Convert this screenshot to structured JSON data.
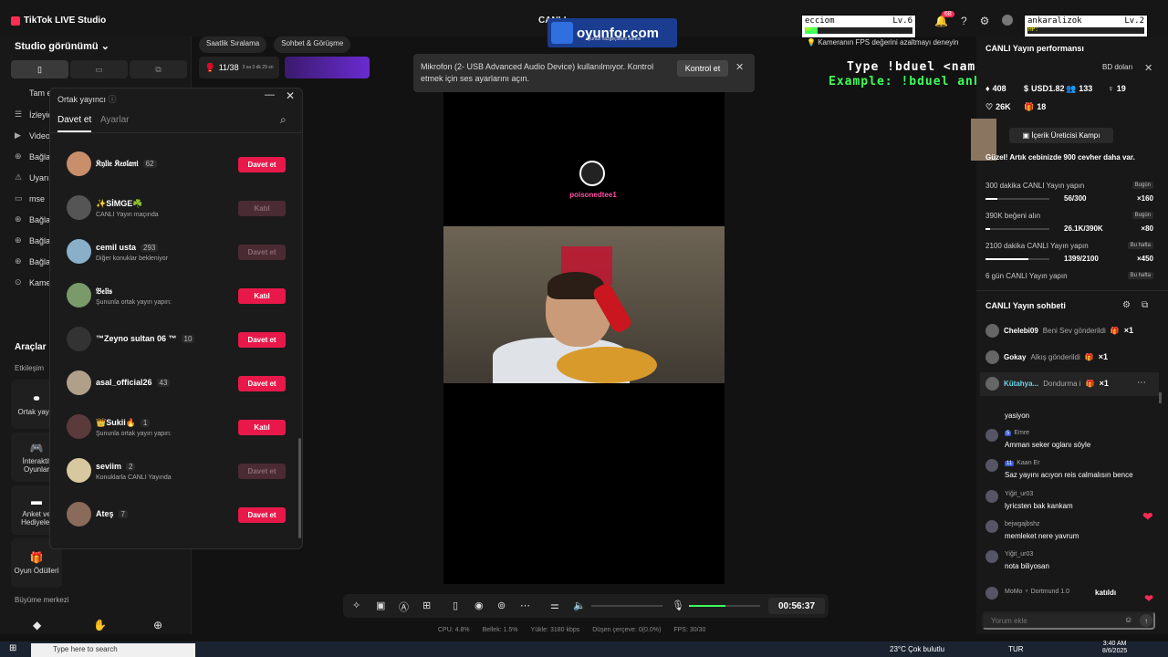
{
  "app": {
    "title": "TikTok LIVE Studio",
    "studio_view": "Studio görünümü",
    "center_title": "CANLI"
  },
  "left_sources": [
    "Tam ekran",
    "İzleyiciler",
    "Video",
    "Bağlantı",
    "Uyarılar",
    "mse",
    "Bağlantı",
    "Bağlantı",
    "Bağlantı",
    "Kamera"
  ],
  "tools": {
    "heading": "Araçlar",
    "sub": "Etkileşim",
    "items": [
      "Ortak yayın",
      "İnteraktif Oyunlar",
      "Anket ve Hediyeler",
      "Oyun Ödülleri"
    ],
    "growth": "Büyüme merkezi"
  },
  "chips": [
    "Saatlik Sıralama",
    "Sohbet & Görüşme"
  ],
  "rank": {
    "value": "11/38",
    "sub": "3 sa 3 dk 29 sn"
  },
  "cohost": {
    "title": "Ortak yayıncı",
    "tab_invite": "Davet et",
    "tab_settings": "Ayarlar",
    "users": [
      {
        "name": "𝔎𝔶𝔩𝔦𝔢 𝔎𝔢𝔬𝔩𝔞𝔫𝔦",
        "count": "62",
        "sub": "",
        "btn": "Davet et",
        "disabled": false,
        "color": "#c88f6a"
      },
      {
        "name": "✨SİMGE☘️",
        "count": "",
        "sub": "CANLI Yayın maçında",
        "btn": "Katıl",
        "disabled": true,
        "color": "#555"
      },
      {
        "name": "cemil usta",
        "count": "293",
        "sub": "Diğer konuklar bekleniyor",
        "btn": "Davet et",
        "disabled": true,
        "color": "#8ab0c9"
      },
      {
        "name": "𝔅𝔢𝔩𝔦𝔰",
        "count": "",
        "sub": "Şununla ortak yayın yapın:",
        "btn": "Katıl",
        "disabled": false,
        "color": "#7a9a6a"
      },
      {
        "name": "™Zeyno sultan 06 ™",
        "count": "10",
        "sub": "",
        "btn": "Davet et",
        "disabled": false,
        "color": "#333"
      },
      {
        "name": "asal_official26",
        "count": "43",
        "sub": "",
        "btn": "Davet et",
        "disabled": false,
        "color": "#b0a08a"
      },
      {
        "name": "👑Sukii🔥",
        "count": "1",
        "sub": "Şununla ortak yayın yapın:",
        "btn": "Katıl",
        "disabled": false,
        "color": "#5a3a3a"
      },
      {
        "name": "seviim",
        "count": "2",
        "sub": "Konuklarla CANLI Yayında",
        "btn": "Davet et",
        "disabled": true,
        "color": "#d8c8a0"
      },
      {
        "name": "Ateş",
        "count": "7",
        "sub": "",
        "btn": "Davet et",
        "disabled": false,
        "color": "#8a6a5a"
      }
    ]
  },
  "notification": {
    "text": "Mikrofon (2- USB Advanced Audio Device) kullanılmıyor. Kontrol etmek için ses ayarlarını açın.",
    "button": "Kontrol et"
  },
  "stream": {
    "channel": "poisonedtee1"
  },
  "overlay": {
    "logo": "oyunfor.com",
    "sub": "oyunun vazgeçilmez adresi",
    "type_line": "Type !bduel <name> to play",
    "example_line": "Example: !bduel ankaralizoktay",
    "players": [
      {
        "name": "ecciom",
        "level": "Lv.6",
        "hp_label": "HP:",
        "hp": 0.12
      },
      {
        "name": "ankaralizok",
        "level": "Lv.2",
        "hp_label": "HP:",
        "hp": 0.0
      }
    ]
  },
  "fps_tip": "Kameranın FPS değerini azaltmayı deneyin",
  "notif_count": "68",
  "perf": {
    "title": "CANLI Yayın performansı",
    "stats": [
      {
        "icon": "♦",
        "value": "408"
      },
      {
        "icon": "$",
        "value": "USD1.82"
      },
      {
        "icon": "👥",
        "value": "133"
      },
      {
        "icon": "♀",
        "value": "19"
      },
      {
        "icon": "♡",
        "value": "26K"
      },
      {
        "icon": "🎁",
        "value": "18"
      }
    ],
    "banner_tail": "BD doları"
  },
  "camp": {
    "label": "İçerik Üreticisi Kampı",
    "msg": "Güzel! Artık cebinizde 900 cevher daha var.",
    "tasks": [
      {
        "title": "300 dakika CANLI Yayın yapın",
        "tag": "Bugün",
        "prog": "56/300",
        "pct": 0.19,
        "reward": "×160"
      },
      {
        "title": "390K beğeni alın",
        "tag": "Bugün",
        "prog": "26.1K/390K",
        "pct": 0.07,
        "reward": "×80"
      },
      {
        "title": "2100 dakika CANLI Yayın yapın",
        "tag": "Bu hafta",
        "prog": "1399/2100",
        "pct": 0.67,
        "reward": "×450"
      },
      {
        "title": "6 gün CANLI Yayın yapın",
        "tag": "Bu hafta",
        "prog": "",
        "pct": 0,
        "reward": ""
      }
    ]
  },
  "chat": {
    "title": "CANLI Yayın sohbeti",
    "gifts": [
      {
        "name": "Chelebi09",
        "action": "Beni Sev gönderildi",
        "x": "×1"
      },
      {
        "name": "Gokay",
        "action": "Alkış gönderildi",
        "x": "×1"
      },
      {
        "name": "Kütahya...",
        "action": "Dondurma i",
        "x": "×1"
      }
    ],
    "messages": [
      {
        "name": "",
        "text": "yasiyon",
        "lvl": ""
      },
      {
        "name": "Emre",
        "text": "Amman seker oglanı söyle",
        "lvl": "5"
      },
      {
        "name": "Kaan Er",
        "text": "Saz yayını acıyon reis calmalısın bence",
        "lvl": "11"
      },
      {
        "name": "Yiğit_ur03",
        "text": "lyricsten bak kankam",
        "lvl": ""
      },
      {
        "name": "bejwgajbshz",
        "text": "memleket nere yavrum",
        "lvl": ""
      },
      {
        "name": "Yiğit_ur03",
        "text": "nota biliyosan",
        "lvl": ""
      },
      {
        "name": "MoMo ♆ Dortmund 1.0",
        "text": "katıldı",
        "lvl": ""
      }
    ],
    "placeholder": "Yorum ekle"
  },
  "controls": {
    "timer": "00:56:37"
  },
  "stats": {
    "cpu": "CPU: 4.8%",
    "mem": "Bellek: 1.5%",
    "upload": "Yükle: 3180 kbps",
    "drop": "Düşen çerçeve: 0(0.0%)",
    "fps": "FPS: 30/30"
  },
  "taskbar": {
    "search": "Type here to search",
    "weather": "23°C Çok bulutlu",
    "lang": "TUR",
    "time": "3:40 AM",
    "date": "8/6/2025"
  }
}
